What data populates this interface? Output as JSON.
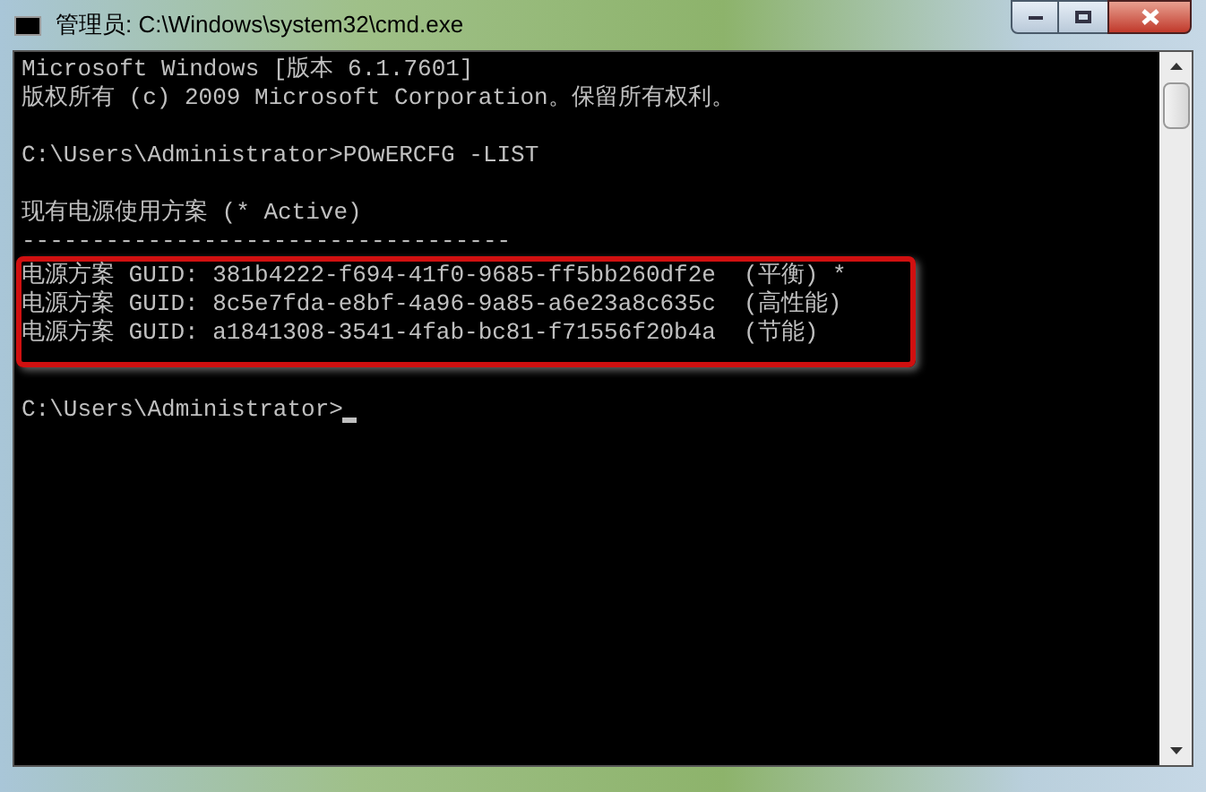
{
  "window": {
    "title": "管理员: C:\\Windows\\system32\\cmd.exe"
  },
  "console": [
    {
      "kind": "text",
      "text": "Microsoft Windows [版本 6.1.7601]"
    },
    {
      "kind": "text",
      "text": "版权所有 (c) 2009 Microsoft Corporation。保留所有权利。"
    },
    {
      "kind": "blank"
    },
    {
      "kind": "text",
      "text": "C:\\Users\\Administrator>POwERCFG -LIST"
    },
    {
      "kind": "blank"
    },
    {
      "kind": "text",
      "text": "现有电源使用方案 (* Active)"
    },
    {
      "kind": "text",
      "text": "-----------------------------------"
    },
    {
      "kind": "highlight",
      "lines": [
        {
          "text": "电源方案 GUID: 381b4222-f694-41f0-9685-ff5bb260df2e  (平衡) *"
        },
        {
          "text": "电源方案 GUID: 8c5e7fda-e8bf-4a96-9a85-a6e23a8c635c  (高性能)"
        },
        {
          "text": "电源方案 GUID: a1841308-3541-4fab-bc81-f71556f20b4a  (节能)"
        }
      ]
    },
    {
      "kind": "blank"
    },
    {
      "kind": "prompt",
      "text": "C:\\Users\\Administrator>",
      "cursor": true
    }
  ]
}
